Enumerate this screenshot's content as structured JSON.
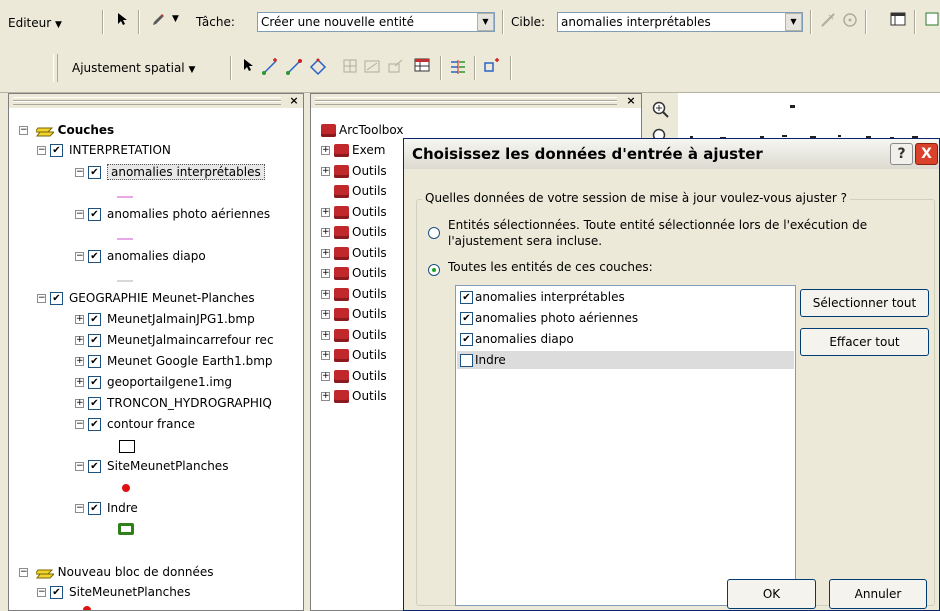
{
  "editor_toolbar": {
    "editor_label": "Editeur",
    "task_label": "Tâche:",
    "task_value": "Créer une nouvelle entité",
    "target_label": "Cible:",
    "target_value": "anomalies interprétables"
  },
  "spatial_toolbar": {
    "adjust_label": "Ajustement spatial"
  },
  "toc": {
    "root_label": "Couches",
    "group1_label": "INTERPRETATION",
    "layers": [
      {
        "label": "anomalies interprétables"
      },
      {
        "label": "anomalies photo aériennes"
      },
      {
        "label": "anomalies diapo"
      }
    ],
    "group2_label": "GEOGRAPHIE Meunet-Planches",
    "group2_layers": [
      {
        "label": "MeunetJalmainJPG1.bmp"
      },
      {
        "label": "MeunetJalmaincarrefour rec"
      },
      {
        "label": "Meunet Google Earth1.bmp"
      },
      {
        "label": "geoportailgene1.img"
      },
      {
        "label": "TRONCON_HYDROGRAPHIQ"
      },
      {
        "label": "contour france"
      },
      {
        "label": "SiteMeunetPlanches"
      },
      {
        "label": "Indre"
      }
    ],
    "frame2_label": "Nouveau bloc de données",
    "frame2_layer": "SiteMeunetPlanches"
  },
  "arctoolbox": {
    "root_label": "ArcToolbox",
    "items": [
      "Exem",
      "Outils",
      "Outils",
      "Outils",
      "Outils",
      "Outils",
      "Outils",
      "Outils",
      "Outils",
      "Outils",
      "Outils",
      "Outils",
      "Outils"
    ]
  },
  "dialog": {
    "title": "Choisissez les données d'entrée à ajuster",
    "help": "?",
    "close": "X",
    "group_label": "Quelles données de votre session de mise à jour voulez-vous ajuster ?",
    "radio1_line1": "Entités sélectionnées. Toute entité sélectionnée lors de l'exécution de",
    "radio1_line2": "l'ajustement sera incluse.",
    "radio2_label": "Toutes les entités de ces couches:",
    "list": [
      {
        "label": "anomalies interprétables",
        "checked": true
      },
      {
        "label": "anomalies photo aériennes",
        "checked": true
      },
      {
        "label": "anomalies diapo",
        "checked": true
      },
      {
        "label": "Indre",
        "checked": false
      }
    ],
    "select_all": "Sélectionner tout",
    "clear_all": "Effacer tout",
    "ok": "OK",
    "cancel": "Annuler"
  },
  "colors": {
    "close_red": "#d9412a",
    "layer_pink": "#e6a8e6",
    "site_red": "#e01010",
    "indre_green": "#2f7f1a"
  }
}
